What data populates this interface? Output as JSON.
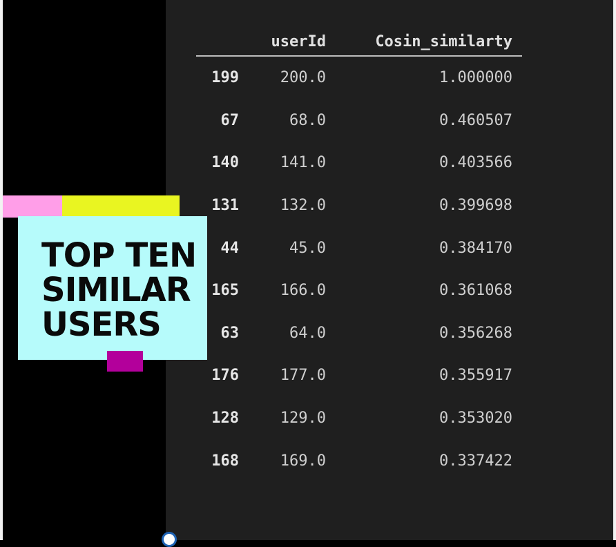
{
  "table": {
    "columns": [
      "",
      "userId",
      "Cosin_similarty"
    ],
    "rows": [
      {
        "index": "199",
        "userId": "200.0",
        "cosine": "1.000000"
      },
      {
        "index": "67",
        "userId": "68.0",
        "cosine": "0.460507"
      },
      {
        "index": "140",
        "userId": "141.0",
        "cosine": "0.403566"
      },
      {
        "index": "131",
        "userId": "132.0",
        "cosine": "0.399698"
      },
      {
        "index": "44",
        "userId": "45.0",
        "cosine": "0.384170"
      },
      {
        "index": "165",
        "userId": "166.0",
        "cosine": "0.361068"
      },
      {
        "index": "63",
        "userId": "64.0",
        "cosine": "0.356268"
      },
      {
        "index": "176",
        "userId": "177.0",
        "cosine": "0.355917"
      },
      {
        "index": "128",
        "userId": "129.0",
        "cosine": "0.353020"
      },
      {
        "index": "168",
        "userId": "169.0",
        "cosine": "0.337422"
      }
    ]
  },
  "note": {
    "title_lines": [
      "TOP TEN",
      "SIMILAR",
      "USERS"
    ]
  },
  "colors": {
    "panel_bg": "#1f1f1f",
    "note_bg": "#b6fbfb",
    "tab_pink": "#ff9ee8",
    "tab_yellow": "#e9f521",
    "tab_magenta": "#b3009b"
  }
}
